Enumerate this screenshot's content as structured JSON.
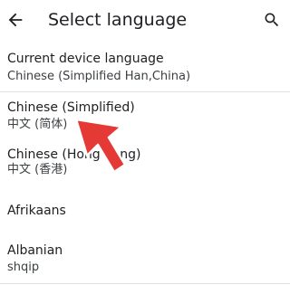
{
  "appbar": {
    "title": "Select language",
    "back_icon": "arrow-back-icon",
    "search_icon": "search-icon"
  },
  "current": {
    "label": "Current device language",
    "value": "Chinese (Simplified Han,China)"
  },
  "languages": [
    {
      "name": "Chinese (Simplified)",
      "native": "中文 (简体)"
    },
    {
      "name": "Chinese (Hong Kong)",
      "native": "中文 (香港)"
    },
    {
      "name": "Afrikaans",
      "native": ""
    },
    {
      "name": "Albanian",
      "native": "shqip"
    }
  ],
  "colors": {
    "text_primary": "#202124",
    "text_secondary": "#3c4043",
    "divider": "#e0e0e0",
    "cursor": "#e53935"
  }
}
